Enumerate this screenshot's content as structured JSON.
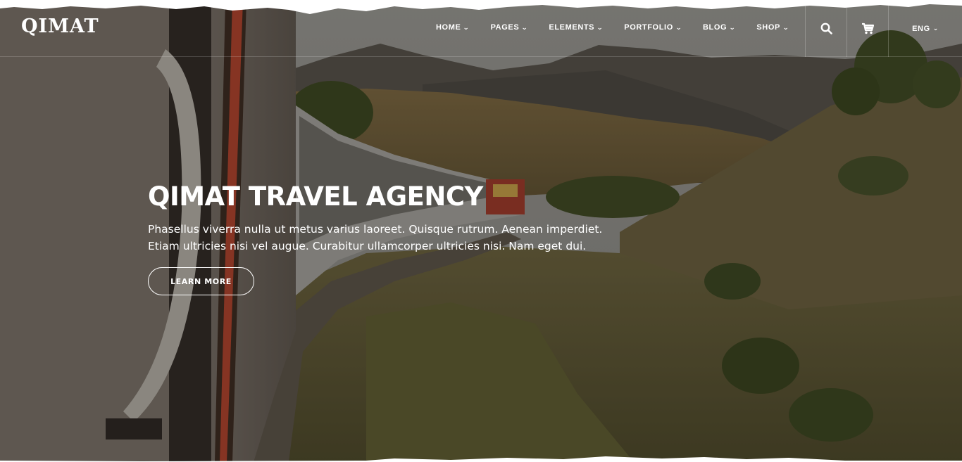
{
  "brand": {
    "logo_text": "QIMAT"
  },
  "nav": {
    "items": [
      {
        "label": "HOME"
      },
      {
        "label": "PAGES"
      },
      {
        "label": "ELEMENTS"
      },
      {
        "label": "PORTFOLIO"
      },
      {
        "label": "BLOG"
      },
      {
        "label": "SHOP"
      }
    ],
    "search_icon": "search-icon",
    "cart_icon": "cart-icon",
    "language": "ENG"
  },
  "hero": {
    "title": "QIMAT TRAVEL AGENCY",
    "text_line1": "Phasellus viverra nulla ut metus varius laoreet. Quisque rutrum. Aenean imperdiet.",
    "text_line2": "Etiam ultricies nisi vel augue. Curabitur ullamcorper ultricies nisi. Nam eget dui.",
    "button_label": "LEARN MORE"
  },
  "colors": {
    "text": "#ffffff",
    "background": "#ffffff"
  }
}
